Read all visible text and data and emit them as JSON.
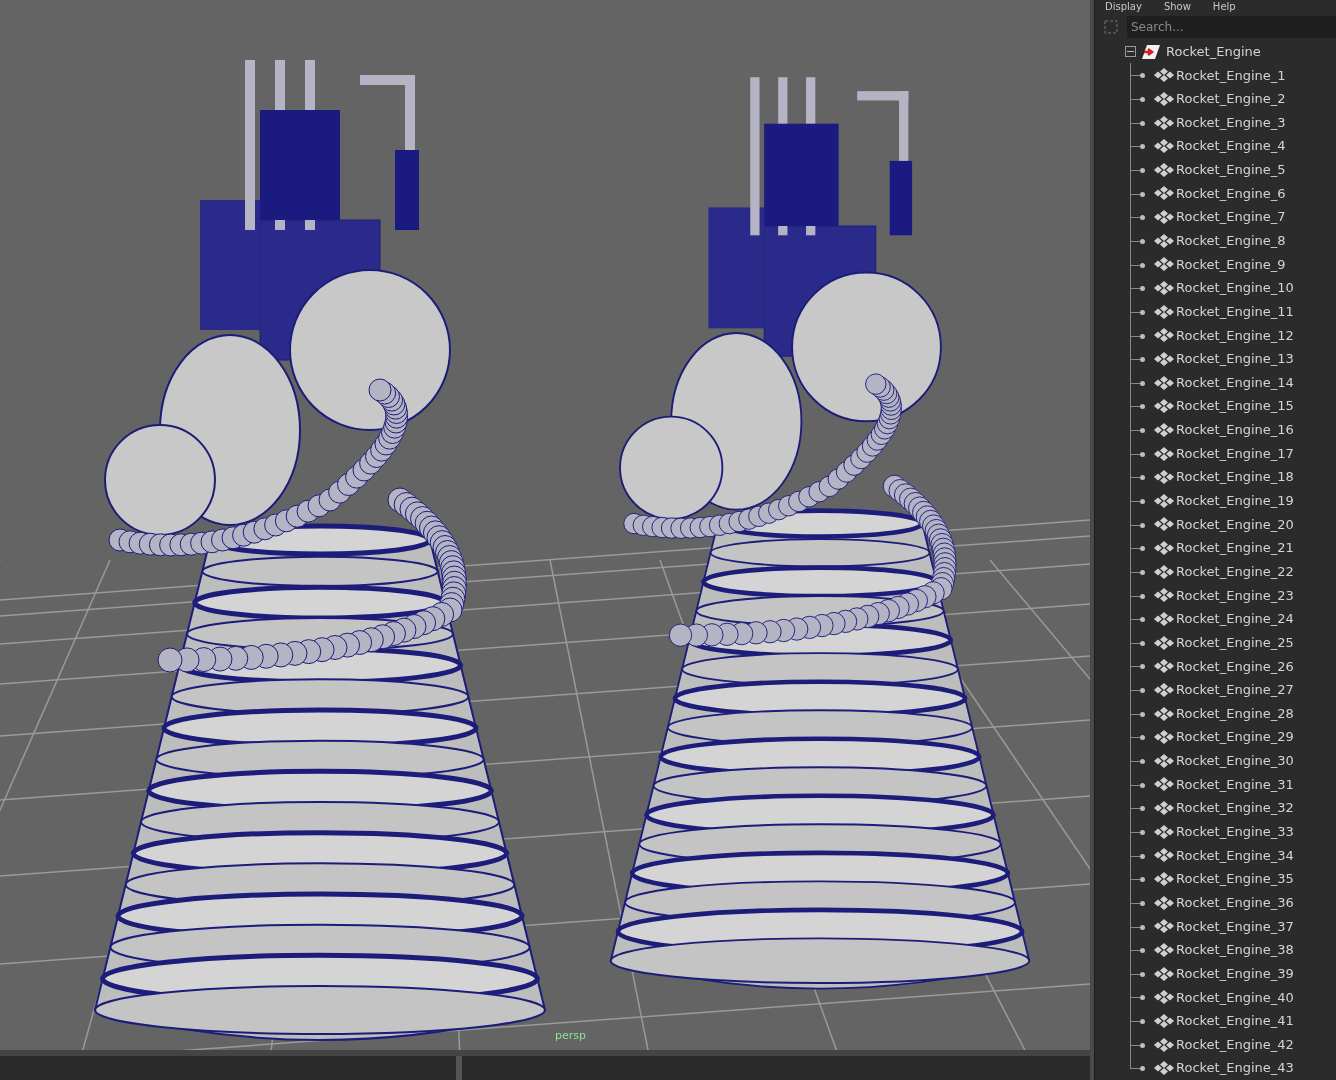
{
  "viewport": {
    "camera_label": "persp"
  },
  "outliner": {
    "menu": [
      "Display",
      "Show",
      "Help"
    ],
    "search": {
      "placeholder": "Search..."
    },
    "tree": [
      {
        "label": "Rocket_Engine",
        "expanded": true,
        "children": [
          {
            "label": "Rocket_Engine_1"
          },
          {
            "label": "Rocket_Engine_2"
          },
          {
            "label": "Rocket_Engine_3"
          },
          {
            "label": "Rocket_Engine_4"
          },
          {
            "label": "Rocket_Engine_5"
          },
          {
            "label": "Rocket_Engine_6"
          },
          {
            "label": "Rocket_Engine_7"
          },
          {
            "label": "Rocket_Engine_8"
          },
          {
            "label": "Rocket_Engine_9"
          },
          {
            "label": "Rocket_Engine_10"
          },
          {
            "label": "Rocket_Engine_11"
          },
          {
            "label": "Rocket_Engine_12"
          },
          {
            "label": "Rocket_Engine_13"
          },
          {
            "label": "Rocket_Engine_14"
          },
          {
            "label": "Rocket_Engine_15"
          },
          {
            "label": "Rocket_Engine_16"
          },
          {
            "label": "Rocket_Engine_17"
          },
          {
            "label": "Rocket_Engine_18"
          },
          {
            "label": "Rocket_Engine_19"
          },
          {
            "label": "Rocket_Engine_20"
          },
          {
            "label": "Rocket_Engine_21"
          },
          {
            "label": "Rocket_Engine_22"
          },
          {
            "label": "Rocket_Engine_23"
          },
          {
            "label": "Rocket_Engine_24"
          },
          {
            "label": "Rocket_Engine_25"
          },
          {
            "label": "Rocket_Engine_26"
          },
          {
            "label": "Rocket_Engine_27"
          },
          {
            "label": "Rocket_Engine_28"
          },
          {
            "label": "Rocket_Engine_29"
          },
          {
            "label": "Rocket_Engine_30"
          },
          {
            "label": "Rocket_Engine_31"
          },
          {
            "label": "Rocket_Engine_32"
          },
          {
            "label": "Rocket_Engine_33"
          },
          {
            "label": "Rocket_Engine_34"
          },
          {
            "label": "Rocket_Engine_35"
          },
          {
            "label": "Rocket_Engine_36"
          },
          {
            "label": "Rocket_Engine_37"
          },
          {
            "label": "Rocket_Engine_38"
          },
          {
            "label": "Rocket_Engine_39"
          },
          {
            "label": "Rocket_Engine_40"
          },
          {
            "label": "Rocket_Engine_41"
          },
          {
            "label": "Rocket_Engine_42"
          },
          {
            "label": "Rocket_Engine_43"
          }
        ]
      }
    ]
  }
}
